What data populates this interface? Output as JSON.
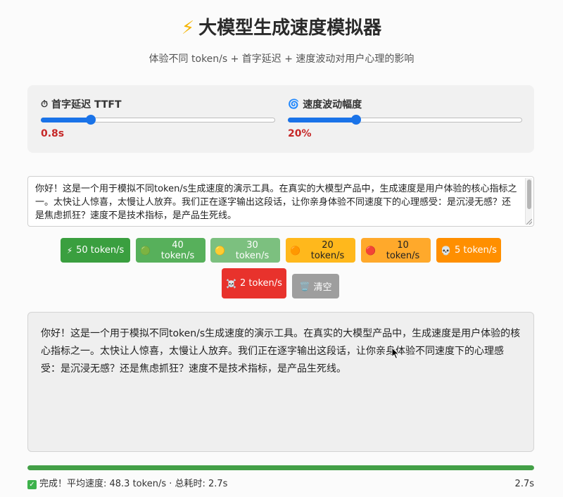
{
  "header": {
    "icon": "lightning-bolt-icon",
    "title": "大模型生成速度模拟器",
    "subtitle": "体验不同 token/s + 首字延迟 + 速度波动对用户心理的影响"
  },
  "controls": {
    "ttft": {
      "icon": "stopwatch-icon",
      "label": "首字延迟 TTFT",
      "value_text": "0.8s",
      "level": 0.21
    },
    "fluctuation": {
      "icon": "cyclone-icon",
      "label": "速度波动幅度",
      "value_text": "20%",
      "level": 0.29
    }
  },
  "input": {
    "text": "你好！这是一个用于模拟不同token/s生成速度的演示工具。在真实的大模型产品中，生成速度是用户体验的核心指标之一。太快让人惊喜，太慢让人放弃。我们正在逐字输出这段话，让你亲身体验不同速度下的心理感受：是沉浸无感？还是焦虑抓狂？速度不是技术指标，是产品生死线。"
  },
  "buttons": [
    {
      "icon": "⚡",
      "icon_name": "lightning-icon",
      "label": "50 token/s",
      "color": "#3a9f3f"
    },
    {
      "icon": "🟢",
      "icon_name": "green-circle-icon",
      "label": "40 token/s",
      "color": "#57b05b"
    },
    {
      "icon": "🟡",
      "icon_name": "yellow-circle-icon",
      "label": "30 token/s",
      "color": "#7cc07f"
    },
    {
      "icon": "🟠",
      "icon_name": "orange-circle-icon",
      "label": "20 token/s",
      "color": "#ffb81c"
    },
    {
      "icon": "🔴",
      "icon_name": "red-circle-icon",
      "label": "10 token/s",
      "color": "#ffa92b"
    },
    {
      "icon": "💀",
      "icon_name": "skull-icon",
      "label": "5 token/s",
      "color": "#ff8f00"
    },
    {
      "icon": "☠️",
      "icon_name": "skull-crossbones-icon",
      "label": "2 token/s",
      "color": "#e8322c"
    },
    {
      "icon": "🗑️",
      "icon_name": "trash-icon",
      "label": "清空",
      "color": "#9e9e9e"
    }
  ],
  "output": {
    "text": "你好！这是一个用于模拟不同token/s生成速度的演示工具。在真实的大模型产品中，生成速度是用户体验的核心指标之一。太快让人惊喜，太慢让人放弃。我们正在逐字输出这段话，让你亲身体验不同速度下的心理感受：是沉浸无感？还是焦虑抓狂？速度不是技术指标，是产品生死线。"
  },
  "status": {
    "progress": 1.0,
    "icon": "check-mark-icon",
    "message": "完成！平均速度: 48.3 token/s · 总耗时: 2.7s",
    "elapsed": "2.7s"
  }
}
